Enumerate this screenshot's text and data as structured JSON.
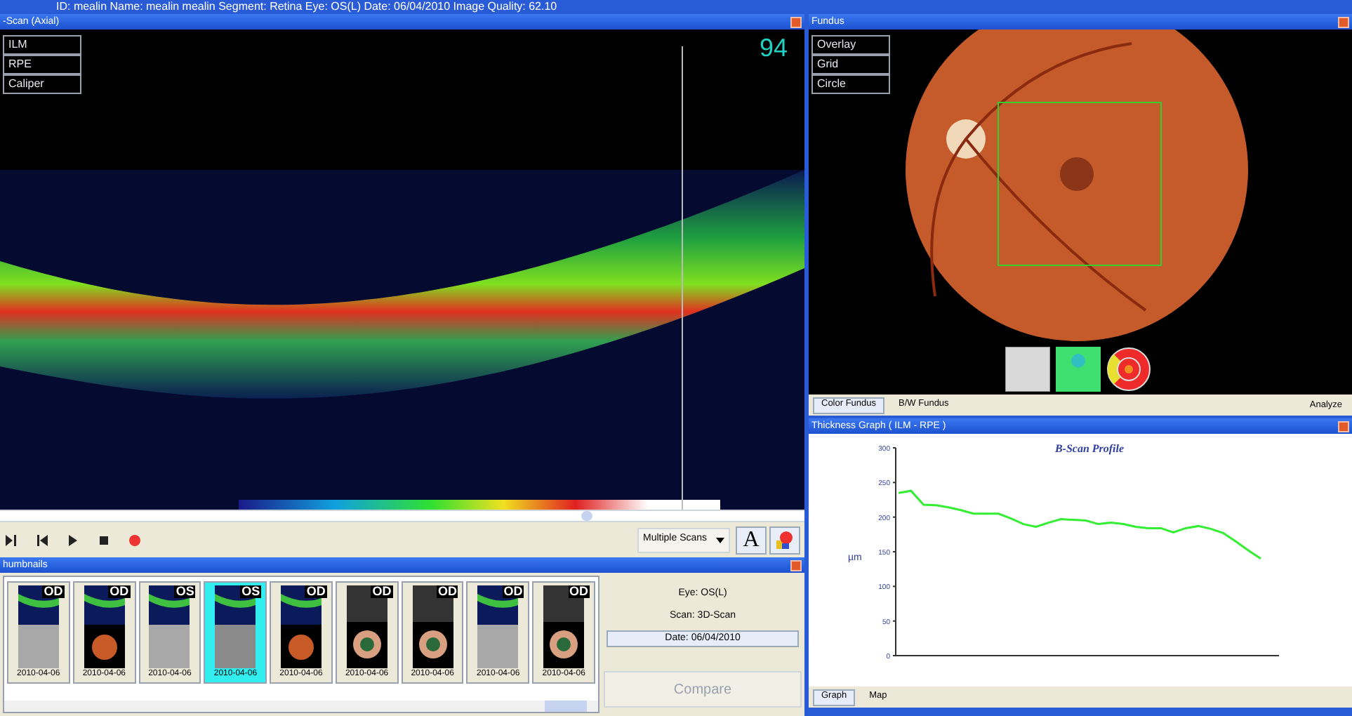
{
  "top_bar": {
    "title": "ID: mealin   Name: mealin mealin   Segment: Retina   Eye: OS(L)   Date: 06/04/2010   Image Quality: 62.10"
  },
  "bscan": {
    "title": "-Scan (Axial)",
    "overlay_buttons": [
      "ILM",
      "RPE",
      "Caliper"
    ],
    "quality": "94",
    "scan_mode": "Multiple Scans",
    "font_button": "A"
  },
  "thumbnails": {
    "title": "humbnails",
    "items": [
      {
        "eye": "OD",
        "date": "2010-04-06",
        "kind": "gray",
        "selected": false
      },
      {
        "eye": "OD",
        "date": "2010-04-06",
        "kind": "color",
        "selected": false
      },
      {
        "eye": "OS",
        "date": "2010-04-06",
        "kind": "gray",
        "selected": false
      },
      {
        "eye": "OS",
        "date": "2010-04-06",
        "kind": "gray",
        "selected": true
      },
      {
        "eye": "OD",
        "date": "2010-04-06",
        "kind": "color",
        "selected": false
      },
      {
        "eye": "OD",
        "date": "2010-04-06",
        "kind": "anterior",
        "selected": false
      },
      {
        "eye": "OD",
        "date": "2010-04-06",
        "kind": "anterior",
        "selected": false
      },
      {
        "eye": "OD",
        "date": "2010-04-06",
        "kind": "gray",
        "selected": false
      },
      {
        "eye": "OD",
        "date": "2010-04-06",
        "kind": "anterior",
        "selected": false
      }
    ],
    "info": [
      "Eye: OS(L)",
      "Scan: 3D-Scan"
    ],
    "date": "Date: 06/04/2010",
    "compare": {
      "label": "Compare",
      "disabled": true
    }
  },
  "fundus": {
    "title": "Fundus",
    "overlay_buttons": [
      "Overlay",
      "Grid",
      "Circle"
    ],
    "tabs": [
      {
        "label": "Color Fundus",
        "selected": true
      },
      {
        "label": "B/W Fundus",
        "selected": false
      }
    ],
    "analyze": "Analyze"
  },
  "thickness": {
    "title": "Thickness Graph  ( ILM - RPE )",
    "tabs": [
      {
        "label": "Graph",
        "selected": true
      },
      {
        "label": "Map",
        "selected": false
      }
    ],
    "chart_data": {
      "type": "line",
      "title": "B-Scan Profile",
      "ylabel": "µm",
      "ylim": [
        0,
        300
      ],
      "yticks": [
        0,
        50,
        100,
        150,
        200,
        250,
        300
      ],
      "series": [
        {
          "color": "#33ee33",
          "values": [
            235,
            238,
            218,
            217,
            214,
            210,
            205,
            205,
            205,
            198,
            190,
            186,
            192,
            197,
            196,
            195,
            190,
            192,
            190,
            186,
            184,
            184,
            178,
            184,
            187,
            183,
            177,
            165,
            152,
            140
          ]
        }
      ]
    }
  }
}
